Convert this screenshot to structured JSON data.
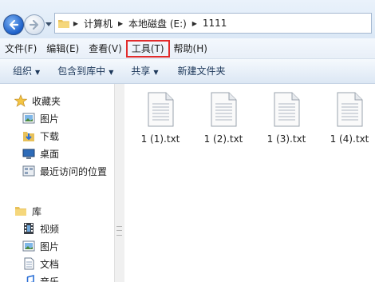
{
  "address": {
    "crumbs": [
      "计算机",
      "本地磁盘 (E:)",
      "1111"
    ]
  },
  "menu": {
    "items": [
      {
        "label": "文件(F)"
      },
      {
        "label": "编辑(E)"
      },
      {
        "label": "查看(V)"
      },
      {
        "label": "工具(T)",
        "highlighted": true
      },
      {
        "label": "帮助(H)"
      }
    ],
    "highlight_color": "#e22b2b"
  },
  "toolbar": {
    "organize": "组织",
    "include_in_library": "包含到库中",
    "share": "共享",
    "new_folder": "新建文件夹"
  },
  "nav": {
    "favorites_header": "收藏夹",
    "favorites": [
      "图片",
      "下载",
      "桌面",
      "最近访问的位置"
    ],
    "libraries_header": "库",
    "libraries": [
      "视频",
      "图片",
      "文档",
      "音乐"
    ]
  },
  "files": [
    {
      "name": "1 (1).txt",
      "icon": "text-file-icon"
    },
    {
      "name": "1 (2).txt",
      "icon": "text-file-icon"
    },
    {
      "name": "1 (3).txt",
      "icon": "text-file-icon"
    },
    {
      "name": "1 (4).txt",
      "icon": "text-file-icon"
    }
  ]
}
